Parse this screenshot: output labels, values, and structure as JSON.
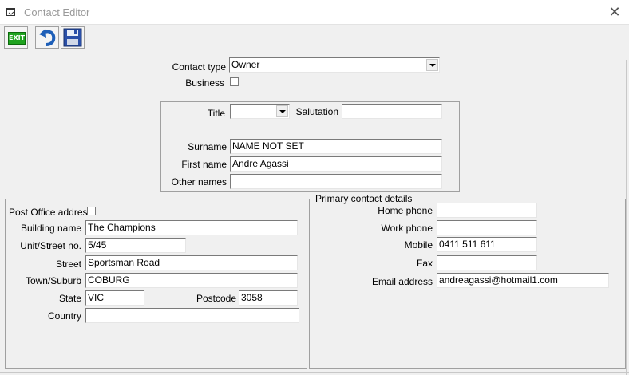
{
  "window": {
    "title": "Contact Editor",
    "close_glyph": "✕"
  },
  "toolbar": {
    "exit_label": "EXIT"
  },
  "contact": {
    "type_label": "Contact type",
    "type_value": "Owner",
    "business_label": "Business",
    "business_checked": false
  },
  "name": {
    "title_label": "Title",
    "title_value": "",
    "salutation_label": "Salutation",
    "salutation_value": "",
    "surname_label": "Surname",
    "surname_value": "NAME NOT SET",
    "firstname_label": "First name",
    "firstname_value": "Andre Agassi",
    "othernames_label": "Other names",
    "othernames_value": ""
  },
  "address": {
    "po_label": "Post Office address",
    "po_checked": false,
    "building_label": "Building name",
    "building_value": "The Champions",
    "unit_label": "Unit/Street no.",
    "unit_value": "5/45",
    "street_label": "Street",
    "street_value": "Sportsman Road",
    "town_label": "Town/Suburb",
    "town_value": "COBURG",
    "state_label": "State",
    "state_value": "VIC",
    "postcode_label": "Postcode",
    "postcode_value": "3058",
    "country_label": "Country",
    "country_value": ""
  },
  "contact_details": {
    "legend": "Primary contact details",
    "home_label": "Home phone",
    "home_value": "",
    "work_label": "Work phone",
    "work_value": "",
    "mobile_label": "Mobile",
    "mobile_value": "0411 511 611",
    "fax_label": "Fax",
    "fax_value": "",
    "email_label": "Email address",
    "email_value": "andreagassi@hotmail1.com"
  },
  "icons": {
    "window": "window-icon",
    "exit": "exit-icon",
    "undo": "undo-icon",
    "save": "save-icon",
    "close": "close-icon"
  },
  "colors": {
    "accent_green": "#1fa31f",
    "undo_blue": "#1e5fb8",
    "save_blue": "#2a4fa8"
  }
}
